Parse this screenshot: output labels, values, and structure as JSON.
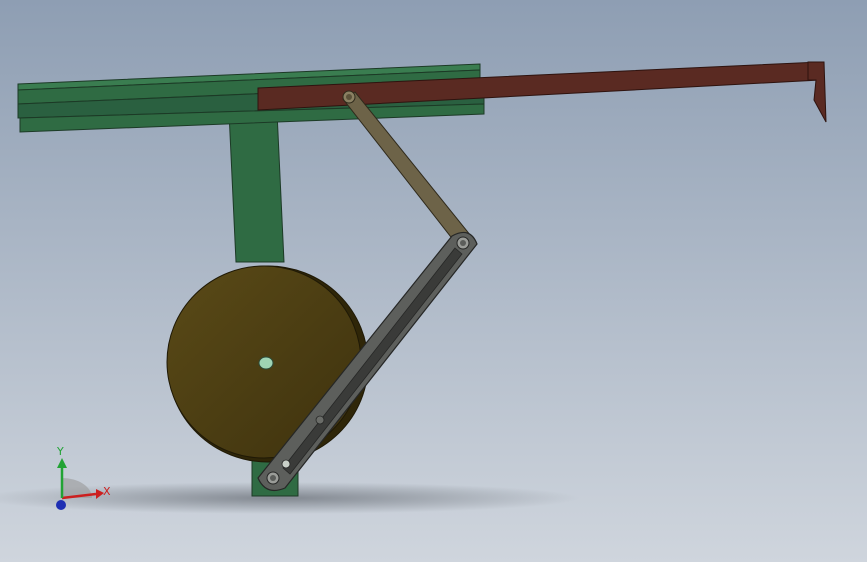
{
  "viewport": {
    "background_top": "#8e9eb3",
    "background_bottom": "#cfd5dd"
  },
  "model": {
    "frame_color": "#2f6b43",
    "frame_edge": "#1c3a26",
    "rail_color": "#5a2a22",
    "rail_edge": "#2e130f",
    "disk_color": "#4a3c12",
    "disk_edge": "#1f1906",
    "link_color": "#6d6348",
    "link_edge": "#2f2a1c",
    "slot_link_color": "#5d5f5c",
    "slot_link_edge": "#262726"
  },
  "triad": {
    "x_label": "X",
    "y_label": "Y",
    "x_color": "#cc1f1f",
    "y_color": "#22a335",
    "z_color": "#1e2fb3"
  }
}
